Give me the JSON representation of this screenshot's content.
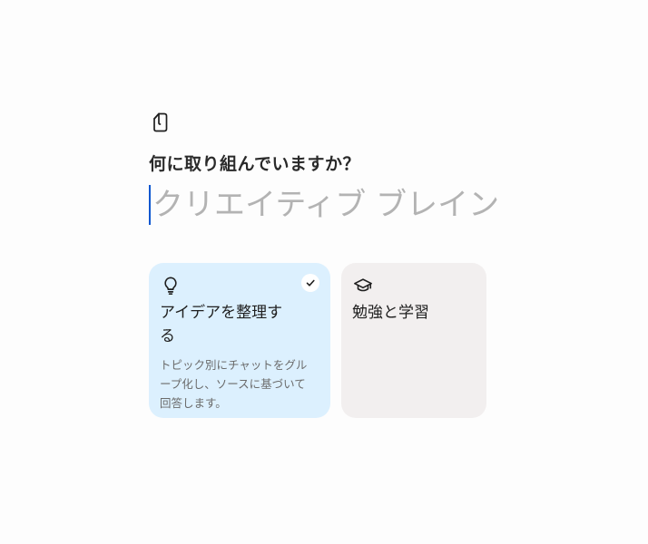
{
  "header": {
    "icon": "notebook-icon",
    "question": "何に取り組んでいますか？"
  },
  "name_field": {
    "value": "",
    "placeholder": "クリエイティブ ブレインストーミング"
  },
  "cards": [
    {
      "icon": "lightbulb-icon",
      "title": "アイデアを整理する",
      "description": "トピック別にチャットをグループ化し、ソースに基づいて回答します。",
      "selected": true
    },
    {
      "icon": "graduation-cap-icon",
      "title": "勉強と学習",
      "selected": false
    }
  ],
  "colors": {
    "selected_card_bg": "#dcf0fe",
    "card_bg": "#f2efef",
    "caret": "#0b57d0",
    "placeholder": "#b3b3b3"
  }
}
